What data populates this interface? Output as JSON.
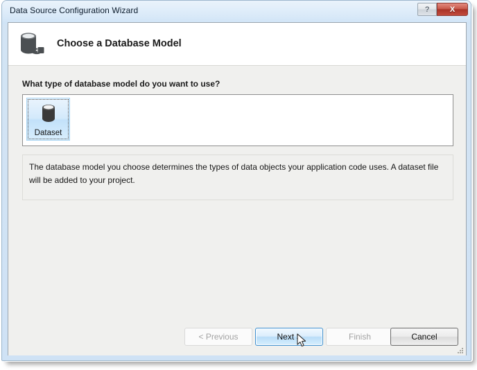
{
  "window": {
    "title": "Data Source Configuration Wizard",
    "help_label": "?",
    "close_label": "X"
  },
  "header": {
    "title": "Choose a Database Model",
    "icon": "database-connection-icon"
  },
  "body": {
    "question": "What type of database model do you want to use?",
    "models": [
      {
        "label": "Dataset",
        "icon": "database-cylinder-icon",
        "selected": true
      }
    ],
    "description": "The database model you choose determines the types of data objects your application code uses. A dataset file will be added to your project."
  },
  "buttons": {
    "previous": "< Previous",
    "next": "Next >",
    "finish": "Finish",
    "cancel": "Cancel"
  },
  "colors": {
    "titlebar": "#dcebf9",
    "frame": "#cfe2f5",
    "client_background": "#f0f0ee",
    "header_background": "#ffffff",
    "selection": "#c2e1fa",
    "close_button": "#c24b3d",
    "hover_button_border": "#3c8fd0"
  }
}
